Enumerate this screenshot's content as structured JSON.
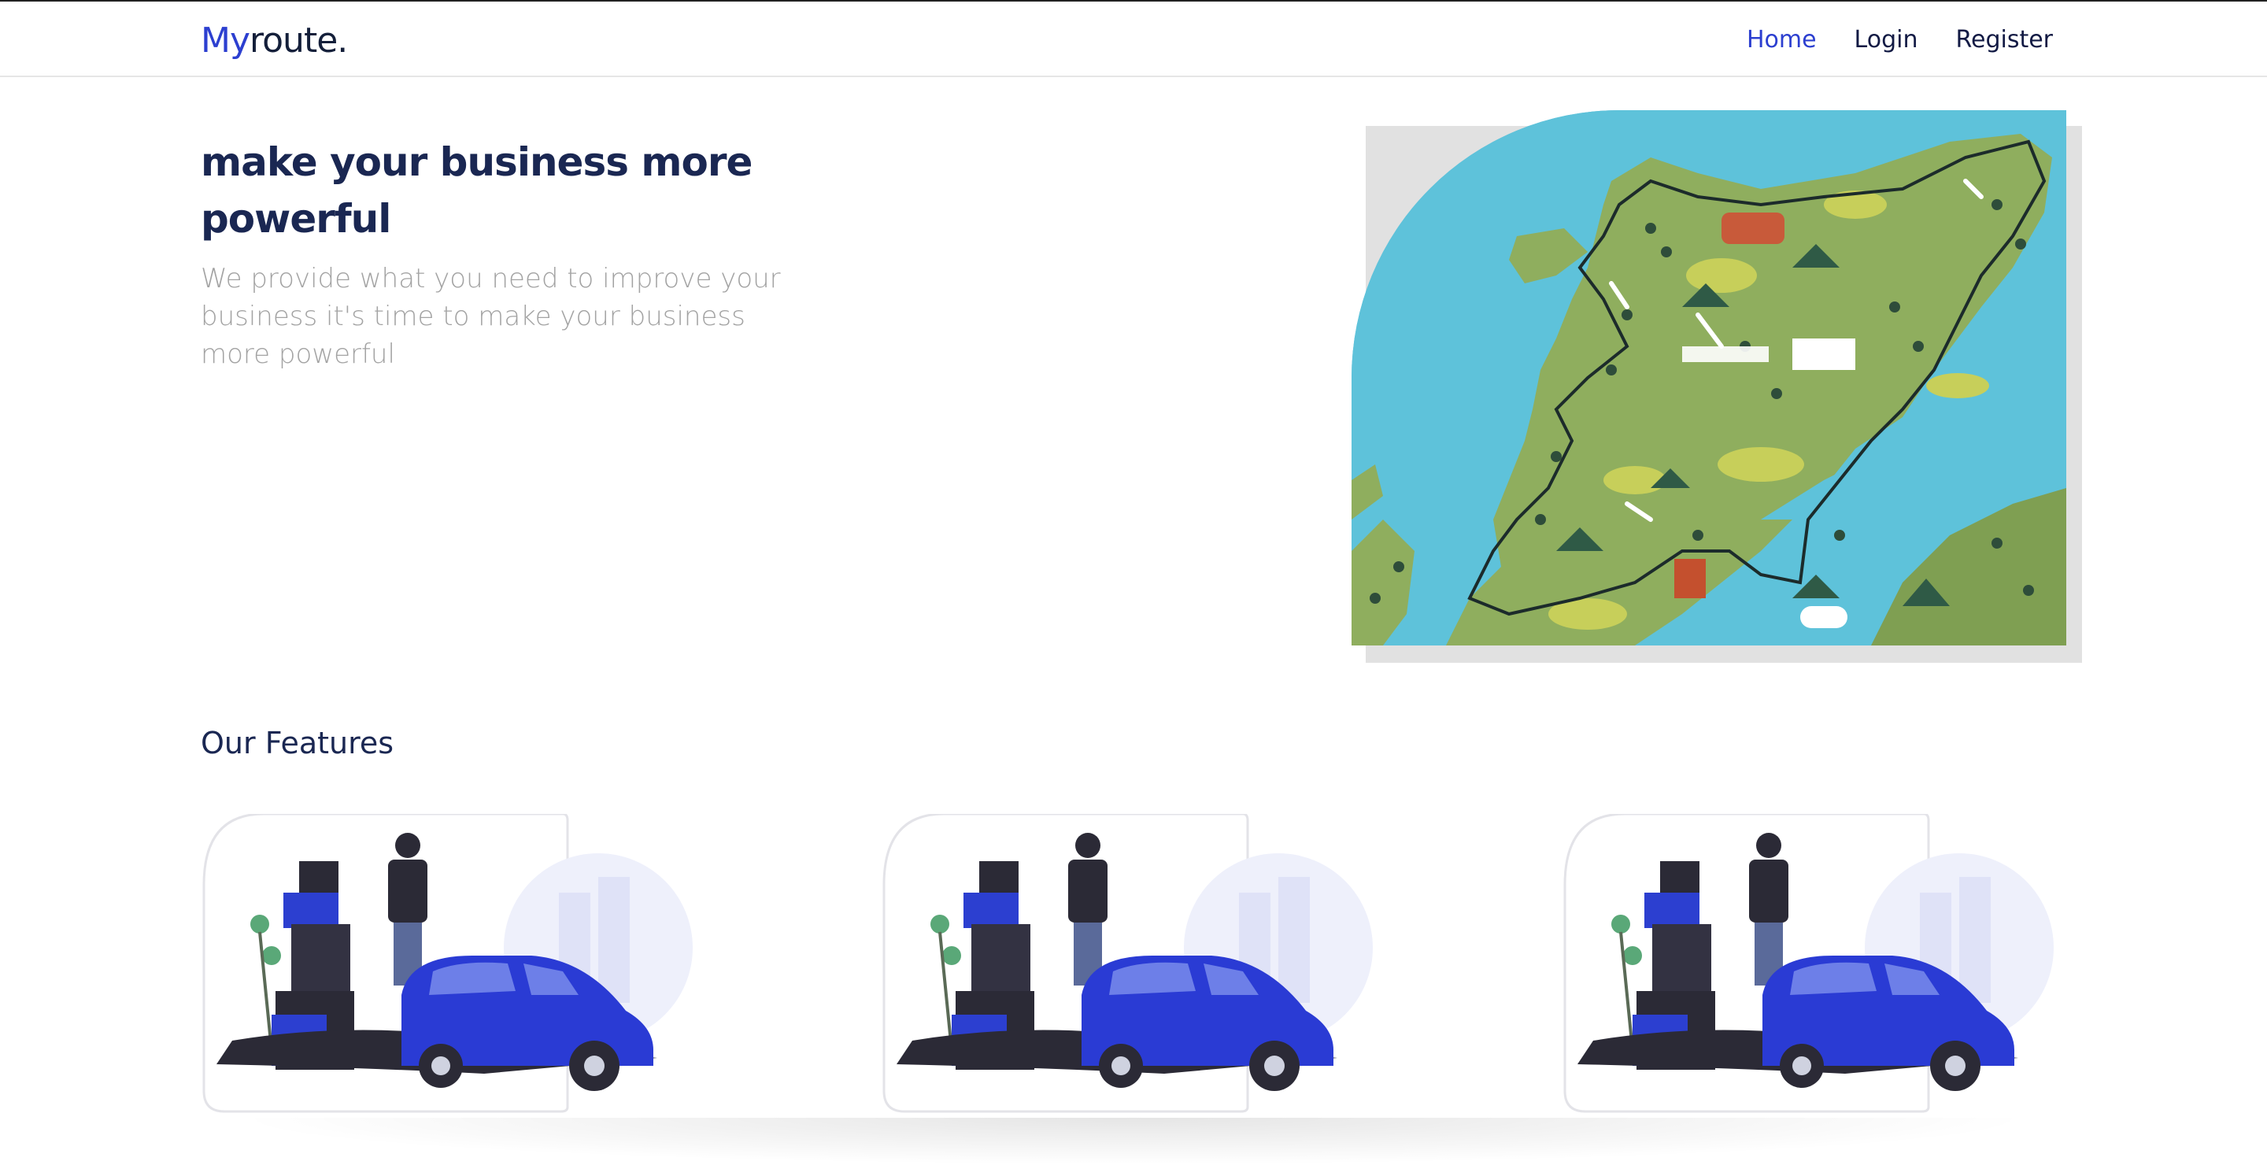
{
  "brand": {
    "prefix": "My",
    "suffix": "route."
  },
  "nav": {
    "links": [
      {
        "label": "Home",
        "active": true
      },
      {
        "label": "Login",
        "active": false
      },
      {
        "label": "Register",
        "active": false
      }
    ]
  },
  "hero": {
    "title": "make your business more powerful",
    "subtitle": "We provide what you need to improve your business it's time to make your business more powerful",
    "image_icon": "illustrated-route-map"
  },
  "features": {
    "title": "Our Features",
    "cards": [
      {
        "image_icon": "delivery-car-illustration"
      },
      {
        "image_icon": "delivery-car-illustration"
      },
      {
        "image_icon": "delivery-car-illustration"
      }
    ]
  },
  "colors": {
    "brand_accent": "#2c3fd0",
    "heading": "#1a2752",
    "muted_text": "#a3a3a3",
    "map_water": "#5ec2da",
    "map_land": "#8fae5e",
    "car_blue": "#2a3bd4"
  }
}
